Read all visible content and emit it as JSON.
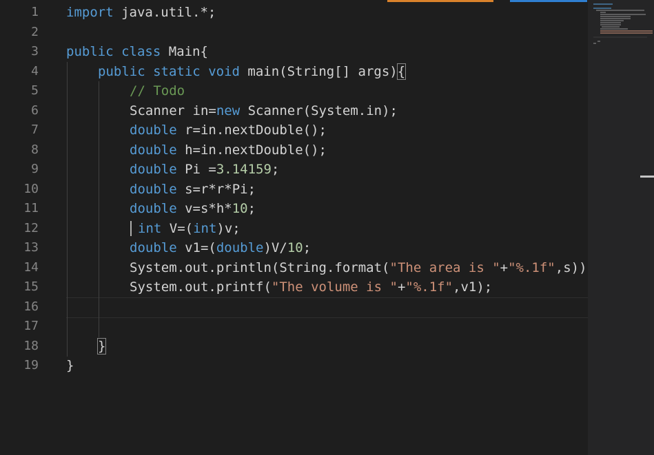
{
  "window": {
    "accent_orange": "#d9822b",
    "accent_blue": "#2f7fd1"
  },
  "editor": {
    "line_numbers": [
      "1",
      "2",
      "3",
      "4",
      "5",
      "6",
      "7",
      "8",
      "9",
      "10",
      "11",
      "12",
      "13",
      "14",
      "15",
      "16",
      "17",
      "18",
      "19"
    ],
    "active_line": "16",
    "colors": {
      "background": "#1e1e1e",
      "keyword": "#569cd6",
      "string": "#ce9178",
      "number": "#b5cea8",
      "comment": "#6a9955",
      "text": "#d4d4d4",
      "line_number": "#858585"
    },
    "lines": {
      "l1": {
        "kw_import": "import",
        "rest": " java.util.*;"
      },
      "l3": {
        "kw_public": "public",
        "kw_class": "class",
        "name": " Main{"
      },
      "l4": {
        "kw_public": "public",
        "kw_static": "static",
        "kw_void": "void",
        "rest": " main(String[] args)",
        "brace": "{"
      },
      "l5": {
        "comment": "// Todo"
      },
      "l6": {
        "a": "Scanner in=",
        "kw_new": "new",
        "b": " Scanner(System.in);"
      },
      "l7": {
        "kw": "double",
        "rest": " r=in.nextDouble();"
      },
      "l8": {
        "kw": "double",
        "rest": " h=in.nextDouble();"
      },
      "l9": {
        "kw": "double",
        "a": " Pi =",
        "num": "3.14159",
        "b": ";"
      },
      "l10": {
        "kw": "double",
        "rest": " s=r*r*Pi;"
      },
      "l11": {
        "kw": "double",
        "a": " v=s*h*",
        "num": "10",
        "b": ";"
      },
      "l12": {
        "kw": "int",
        "a": " V=(",
        "kw2": "int",
        "b": ")v;"
      },
      "l13": {
        "kw": "double",
        "a": " v1=(",
        "kw2": "double",
        "b": ")V/",
        "num": "10",
        "c": ";"
      },
      "l14": {
        "a": "System.out.println(String.format(",
        "s1": "\"The area is \"",
        "b": "+",
        "s2": "\"%.1f\"",
        "c": ",s))"
      },
      "l15": {
        "a": "System.out.printf(",
        "s1": "\"The volume is \"",
        "b": "+",
        "s2": "\"%.1f\"",
        "c": ",v1);"
      },
      "l18": {
        "brace": "}"
      },
      "l19": {
        "brace": "}"
      }
    }
  },
  "minimap": {
    "lines": [
      "import java.util.*;",
      "public class Main{",
      "public static void main(String[] args){",
      "// Todo",
      "Scanner in=new Scanner(System.in);",
      "double r=in.nextDouble();",
      "double h=in.nextDouble();",
      "double Pi =3.14159;",
      "double s=r*r*Pi;",
      "double v=s*h*10;",
      "int V=(int)v;",
      "double v1=(double)V/10;",
      "System.out.println(String.format(\"The area is \"+\"%.1f\",s))",
      "System.out.printf(\"The volume is \"+\"%.1f\",v1);",
      "}",
      "}"
    ]
  }
}
